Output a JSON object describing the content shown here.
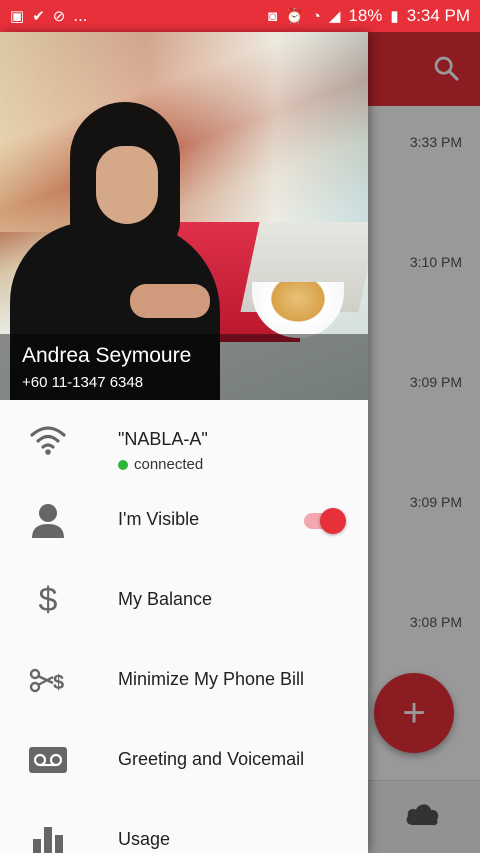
{
  "status_bar": {
    "battery": "18%",
    "time": "3:34 PM",
    "overflow_text": "..."
  },
  "background_app": {
    "times": [
      "3:33 PM",
      "3:10 PM",
      "3:09 PM",
      "3:09 PM",
      "3:08 PM"
    ],
    "fab_label": "+"
  },
  "drawer": {
    "header": {
      "name": "Andrea Seymoure",
      "phone": "+60 11-1347 6348"
    },
    "items": [
      {
        "icon": "wifi-icon",
        "label": "\"NABLA-A\"",
        "sub": "connected"
      },
      {
        "icon": "person-icon",
        "label": "I'm Visible",
        "toggle_on": true
      },
      {
        "icon": "dollar-icon",
        "label": "My Balance"
      },
      {
        "icon": "scissors-dollar-icon",
        "label": "Minimize My Phone Bill"
      },
      {
        "icon": "voicemail-icon",
        "label": "Greeting and Voicemail"
      },
      {
        "icon": "usage-icon",
        "label": "Usage"
      }
    ]
  },
  "colors": {
    "accent": "#e8303a",
    "connected": "#2db53a"
  }
}
